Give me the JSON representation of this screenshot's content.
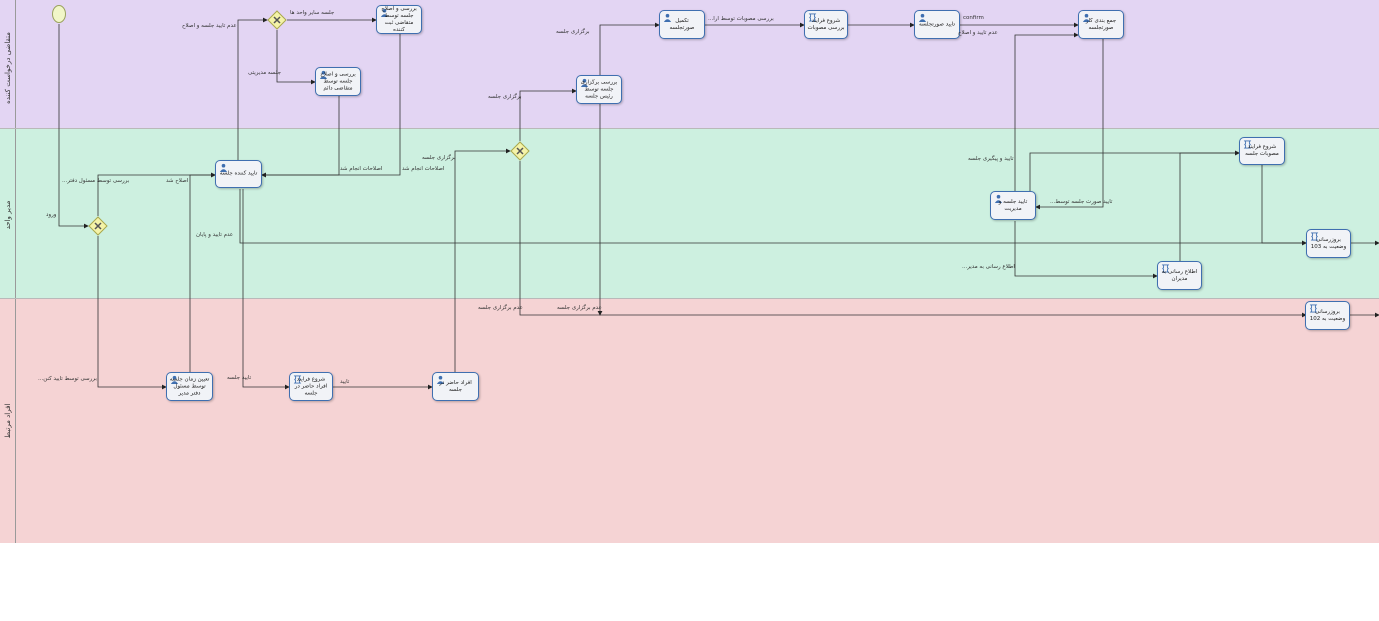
{
  "lanes": [
    {
      "id": "lane-0",
      "title": "متقاضی درخواست کننده",
      "color": "#e3d5f3"
    },
    {
      "id": "lane-1",
      "title": "مدیر واحد",
      "color": "#cdf0e0"
    },
    {
      "id": "lane-2",
      "title": "افراد مرتبط",
      "color": "#f5d3d4"
    }
  ],
  "tasks": {
    "t_review_edit": "بررسی و اصلاح جلسه توسط متقاضی ثبت کننده",
    "t_review_absent": "بررسی و اصلاح جلسه توسط متقاضی دائم",
    "t_confirm_session": "تایید کننده جلسه",
    "t_review_hold": "بررسی برگزاری جلسه توسط رئیس جلسه",
    "t_minutes": "تکمیل صورتجلسه",
    "t_start_review": "شروع فرآیند بررسی مصوبات",
    "t_confirm_minutes": "تایید صورتجلسه",
    "t_collect": "جمع بندی کار صورتجلسه",
    "t_manager_confirm": "تایید جلسه و مدیریت",
    "t_start_approvals": "شروع فرآیند مصوبات جلسه",
    "t_update": "بروزرسانی وضعیت به 103",
    "t_notify": "اطلاع رسانی به مدیران",
    "t_update2": "بروزرسانی وضعیت به 102",
    "t_determine": "تعیین زمان جلسه توسط مسئول دفتر مدیر",
    "t_start_attend": "شروع فرآیند افراد حاضر در جلسه",
    "t_attend": "افراد حاضر در جلسه"
  },
  "edge_labels": {
    "l_session_other": "جلسه سایر واحد ها",
    "l_no_confirm_edit": "عدم تایید جلسه و اصلاح",
    "l_session_manager": "جلسه مدیریتی",
    "l_hold": "برگزاری جلسه",
    "l_hold2": "برگزاری جلسه",
    "l_hold3": "برگزاری جلسه",
    "l_review_approvals": "بررسی مصوبات توسط ارا...",
    "l_confirm": "confirm",
    "l_no_confirm_fix": "عدم تایید و اصلاح",
    "l_applicant_review": "بررسی توسط مسئول دفتر...",
    "l_fixed": "اصلاح شد",
    "l_fix_done": "اصلاحات انجام شد",
    "l_fix_done2": "اصلاحات انجام شد",
    "l_confirm_hold": "تایید و پیگیری جلسه",
    "l_confirm_minutes_by": "تایید صورت جلسه توسط...",
    "l_no_confirm_end": "عدم تایید و پایان",
    "l_notify_to": "اطلاع رسانی به مدیر...",
    "l_not_held": "عدم برگزاری جلسه",
    "l_not_held2": "عدم برگزاری جلسه",
    "l_session_confirm": "تایید جلسه",
    "l_confirm2": "تایید",
    "l_review_confirm": "بررسی توسط تایید کنن...",
    "l_gateway_in": "ورود"
  },
  "icons": {
    "user_task": "user-task-icon",
    "script_task": "script-task-icon",
    "gateway": "exclusive-gateway-icon",
    "start": "start-event-icon"
  }
}
